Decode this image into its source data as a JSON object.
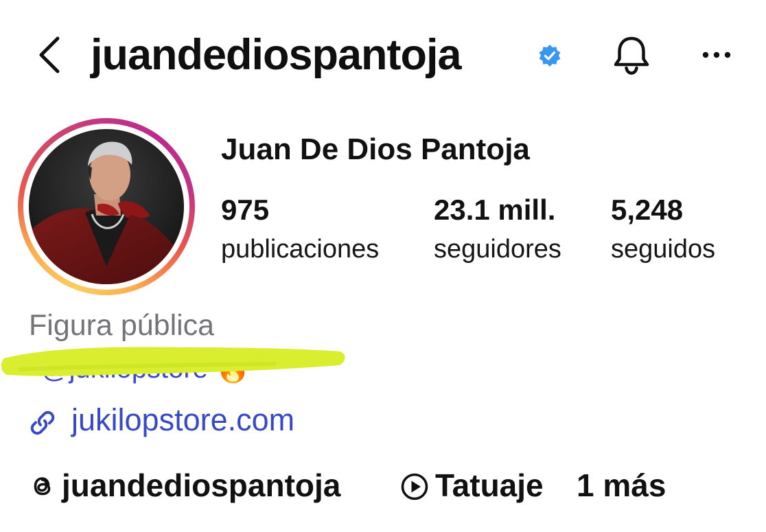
{
  "header": {
    "username": "juandediospantoja",
    "verified_color": "#3897f0"
  },
  "profile": {
    "full_name": "Juan De Dios Pantoja",
    "stats": {
      "posts_count": "975",
      "posts_label": "publicaciones",
      "followers_count": "23.1 mill.",
      "followers_label": "seguidores",
      "following_count": "5,248",
      "following_label": "seguidos"
    }
  },
  "bio": {
    "category": "Figura pública",
    "handle_partial": "@jukilopstore 🔥",
    "highlight_color": "#d8ee2e",
    "website": "jukilopstore.com"
  },
  "links": {
    "threads_handle": "juandediospantoja",
    "music_title": "Tatuaje",
    "more_label": "1 más"
  },
  "icons": {
    "back": "chevron-left-icon",
    "verified": "verified-badge-icon",
    "bell": "bell-icon",
    "more": "more-horizontal-icon",
    "link": "link-icon",
    "threads": "threads-icon",
    "play": "play-circle-icon"
  },
  "colors": {
    "link_blue": "#3849c6",
    "category_gray": "#73737a"
  }
}
